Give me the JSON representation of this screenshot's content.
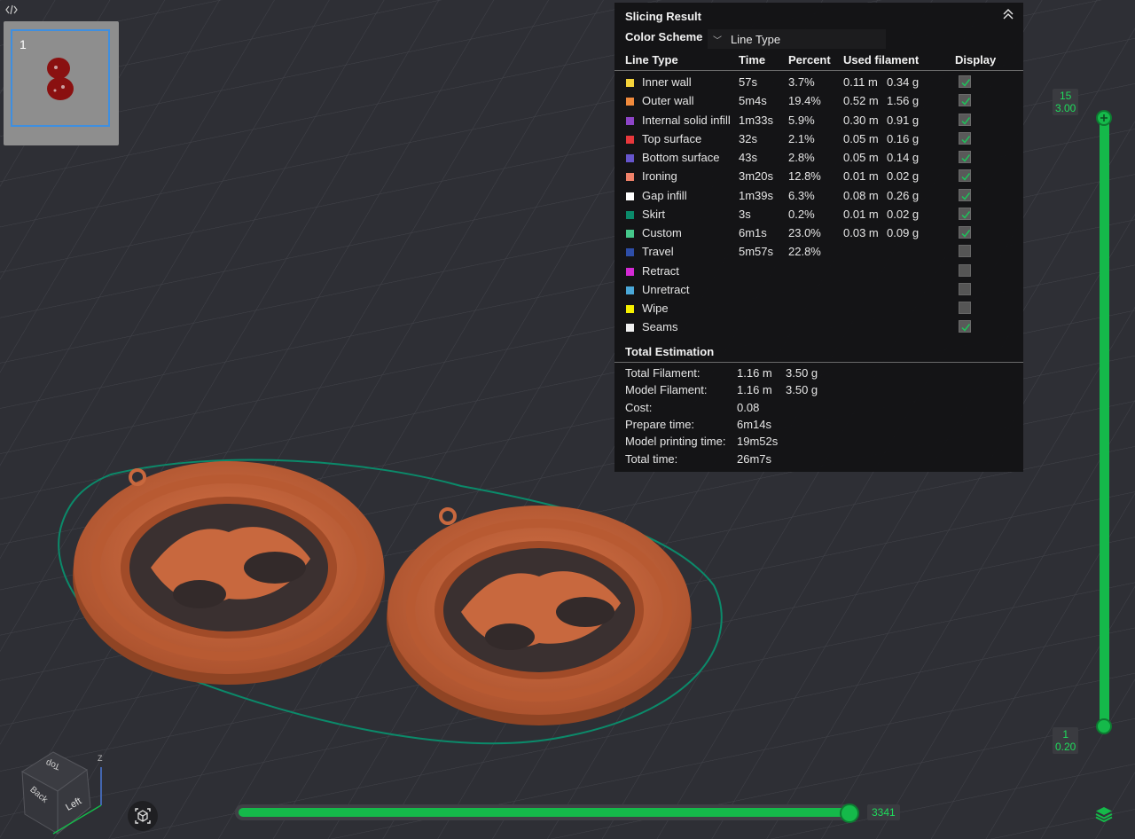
{
  "plate": {
    "number": "1"
  },
  "panel": {
    "title": "Slicing Result",
    "color_scheme_label": "Color Scheme",
    "color_scheme_value": "Line Type",
    "headers": {
      "line_type": "Line Type",
      "time": "Time",
      "percent": "Percent",
      "used_filament": "Used filament",
      "display": "Display"
    },
    "rows": [
      {
        "name": "Inner wall",
        "time": "57s",
        "percent": "3.7%",
        "length": "0.11 m",
        "weight": "0.34 g",
        "color": "#f5d33a",
        "display": true
      },
      {
        "name": "Outer wall",
        "time": "5m4s",
        "percent": "19.4%",
        "length": "0.52 m",
        "weight": "1.56 g",
        "color": "#f08a3c",
        "display": true
      },
      {
        "name": "Internal solid infill",
        "time": "1m33s",
        "percent": "5.9%",
        "length": "0.30 m",
        "weight": "0.91 g",
        "color": "#8d44c7",
        "display": true
      },
      {
        "name": "Top surface",
        "time": "32s",
        "percent": "2.1%",
        "length": "0.05 m",
        "weight": "0.16 g",
        "color": "#e8383c",
        "display": true
      },
      {
        "name": "Bottom surface",
        "time": "43s",
        "percent": "2.8%",
        "length": "0.05 m",
        "weight": "0.14 g",
        "color": "#6655cc",
        "display": true
      },
      {
        "name": "Ironing",
        "time": "3m20s",
        "percent": "12.8%",
        "length": "0.01 m",
        "weight": "0.02 g",
        "color": "#f0826a",
        "display": true
      },
      {
        "name": "Gap infill",
        "time": "1m39s",
        "percent": "6.3%",
        "length": "0.08 m",
        "weight": "0.26 g",
        "color": "#ffffff",
        "display": true
      },
      {
        "name": "Skirt",
        "time": "3s",
        "percent": "0.2%",
        "length": "0.01 m",
        "weight": "0.02 g",
        "color": "#0b8a6a",
        "display": true
      },
      {
        "name": "Custom",
        "time": "6m1s",
        "percent": "23.0%",
        "length": "0.03 m",
        "weight": "0.09 g",
        "color": "#45c88b",
        "display": true
      },
      {
        "name": "Travel",
        "time": "5m57s",
        "percent": "22.8%",
        "length": "",
        "weight": "",
        "color": "#2e4ea8",
        "display": false
      },
      {
        "name": "Retract",
        "time": "",
        "percent": "",
        "length": "",
        "weight": "",
        "color": "#d42ad4",
        "display": false
      },
      {
        "name": "Unretract",
        "time": "",
        "percent": "",
        "length": "",
        "weight": "",
        "color": "#4aa8d8",
        "display": false
      },
      {
        "name": "Wipe",
        "time": "",
        "percent": "",
        "length": "",
        "weight": "",
        "color": "#f5f000",
        "display": false
      },
      {
        "name": "Seams",
        "time": "",
        "percent": "",
        "length": "",
        "weight": "",
        "color": "#f0f0f0",
        "display": true
      }
    ],
    "total_title": "Total Estimation",
    "totals": [
      {
        "label": "Total Filament:",
        "v1": "1.16 m",
        "v2": "3.50 g"
      },
      {
        "label": "Model Filament:",
        "v1": "1.16 m",
        "v2": "3.50 g"
      },
      {
        "label": "Cost:",
        "v1": "0.08",
        "v2": ""
      },
      {
        "label": "Prepare time:",
        "v1": "6m14s",
        "v2": ""
      },
      {
        "label": "Model printing time:",
        "v1": "19m52s",
        "v2": ""
      },
      {
        "label": "Total time:",
        "v1": "26m7s",
        "v2": ""
      }
    ]
  },
  "layer_slider": {
    "top_layer": "15",
    "top_height": "3.00",
    "bottom_layer": "1",
    "bottom_height": "0.20"
  },
  "move_slider": {
    "value": "3341"
  },
  "nav_cube": {
    "top": "Top",
    "left": "Left",
    "back": "Back",
    "z": "Z"
  },
  "colors": {
    "accent": "#15b94a",
    "model": "#c8683e",
    "skirt": "#0b8a6a",
    "thumb_model": "#8a1010"
  }
}
